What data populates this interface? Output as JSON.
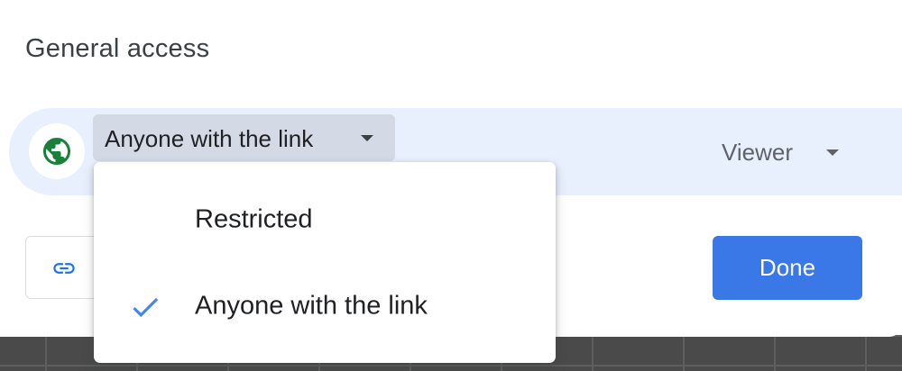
{
  "section": {
    "title": "General access"
  },
  "access": {
    "selected_label": "Anyone with the link",
    "role_label": "Viewer",
    "icon": "globe-icon",
    "icon_color": "#188038",
    "row_background": "#e8f0fe"
  },
  "dropdown": {
    "items": [
      {
        "label": "Restricted",
        "selected": false
      },
      {
        "label": "Anyone with the link",
        "selected": true
      }
    ],
    "check_icon": "check-icon",
    "check_color": "#4285f4"
  },
  "actions": {
    "copy_link_icon": "link-icon",
    "done_label": "Done",
    "accent": "#3b78e7"
  }
}
